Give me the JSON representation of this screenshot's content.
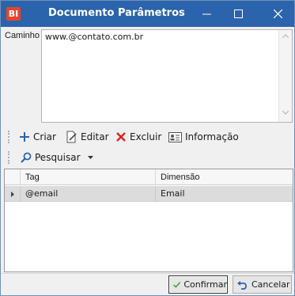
{
  "window": {
    "app_icon_text": "BI",
    "title": "Documento Parâmetros",
    "icons": [
      "minimize-icon",
      "maximize-icon",
      "close-icon"
    ]
  },
  "path": {
    "label": "Caminho",
    "value": "www.@contato.com.br"
  },
  "toolbar": {
    "create_label": "Criar",
    "edit_label": "Editar",
    "delete_label": "Excluir",
    "info_label": "Informação",
    "search_label": "Pesquisar"
  },
  "grid": {
    "columns": [
      "Tag",
      "Dimensão"
    ],
    "rows": [
      {
        "tag": "@email",
        "dimension": "Email"
      }
    ]
  },
  "buttons": {
    "confirm_label": "Confirmar",
    "cancel_label": "Cancelar"
  },
  "colors": {
    "titlebar": "#2b64ac",
    "app_icon": "#e8432b",
    "add_icon": "#2b64ac",
    "delete_icon": "#d9261c",
    "confirm_check": "#3a9c3a",
    "selected_row": "#dcdcdc"
  }
}
